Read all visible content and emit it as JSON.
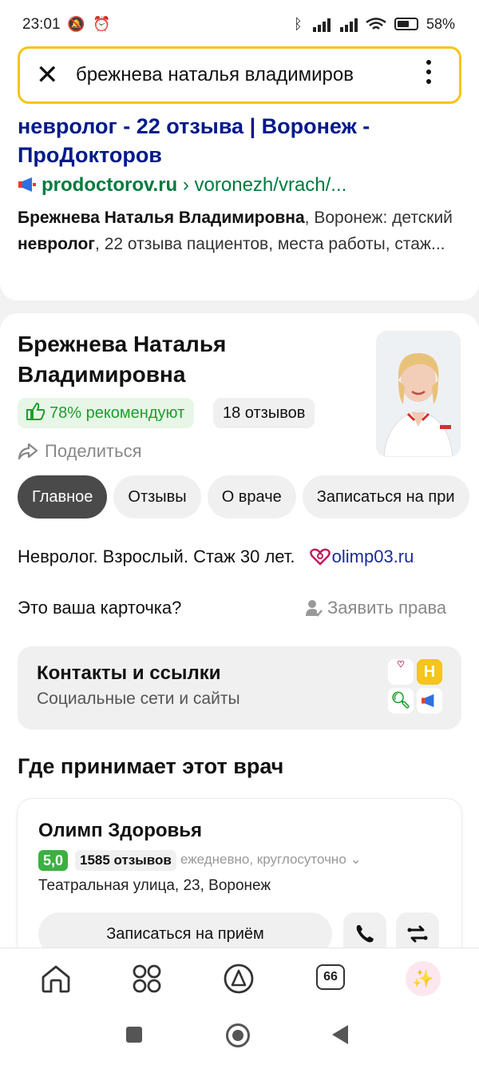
{
  "status_bar": {
    "time": "23:01",
    "battery": "58%"
  },
  "search": {
    "query": "брежнева наталья владимиров"
  },
  "result": {
    "title": "невролог - 22 отзыва | Воронеж - ПроДокторов",
    "url_domain": "prodoctorov.ru",
    "url_path": " › voronezh/vrach/...",
    "snippet": {
      "bold1": "Брежнева Наталья Владимировна",
      "text1": ", Воронеж: детский ",
      "bold2": "невролог",
      "text2": ", 22 отзыва пациентов, места работы, стаж..."
    }
  },
  "profile": {
    "name": "Брежнева Наталья Владимировна",
    "recommend": "78% рекомендуют",
    "reviews_count": "18 отзывов",
    "share": "Поделиться",
    "tabs": [
      "Главное",
      "Отзывы",
      "О враче",
      "Записаться на при"
    ],
    "description": "Невролог. Взрослый. Стаж 30 лет.",
    "site": "olimp03.ru",
    "owner_question": "Это ваша карточка?",
    "claim": "Заявить права",
    "contacts": {
      "title": "Контакты и ссылки",
      "subtitle": "Социальные сети и сайты"
    },
    "where_title": "Где принимает этот врач",
    "clinic": {
      "name": "Олимп Здоровья",
      "rating": "5,0",
      "reviews": "1585 отзывов",
      "hours": "ежедневно, круглосуточно",
      "address": "Театральная улица, 23, Воронеж",
      "book": "Записаться на приём"
    }
  },
  "bottom_nav": {
    "tabs_count": "66"
  },
  "colors": {
    "accent_yellow": "#f5c518",
    "link_blue": "#001a8a",
    "url_green": "#007a3d",
    "recommend_green": "#1f9d2f",
    "rating_green": "#3cb043"
  },
  "icons": [
    "close-icon",
    "more-vert-icon",
    "megaphone-icon",
    "thumbs-up-icon",
    "share-icon",
    "heart-logo-icon",
    "user-check-icon",
    "phone-icon",
    "route-icon",
    "home-icon",
    "services-grid-icon",
    "alice-icon",
    "tabs-icon",
    "sparkle-icon"
  ]
}
